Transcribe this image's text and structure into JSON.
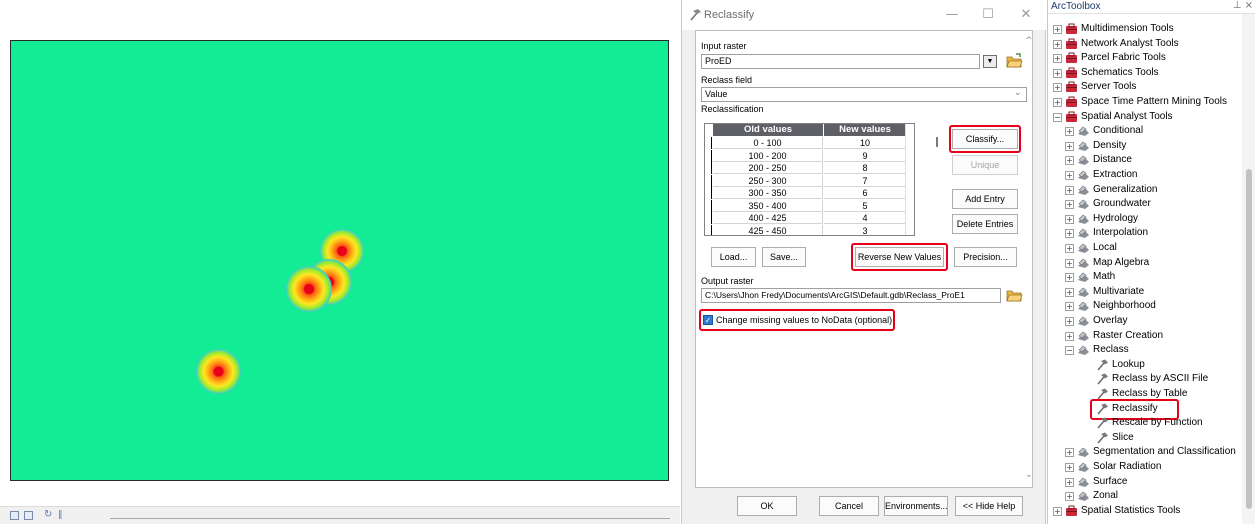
{
  "colors": {
    "raster_background": "#12ec94",
    "highlight": "#e6001a",
    "table_header": "#5f6066"
  },
  "dialog": {
    "title": "Reclassify",
    "input_raster": {
      "label": "Input raster",
      "value": "ProED"
    },
    "reclass_field": {
      "label": "Reclass field",
      "value": "Value"
    },
    "reclassification_label": "Reclassification",
    "table": {
      "columns": [
        "Old values",
        "New values"
      ],
      "rows": [
        {
          "old": "0 - 100",
          "new": "10"
        },
        {
          "old": "100 - 200",
          "new": "9"
        },
        {
          "old": "200 - 250",
          "new": "8"
        },
        {
          "old": "250 - 300",
          "new": "7"
        },
        {
          "old": "300 - 350",
          "new": "6"
        },
        {
          "old": "350 - 400",
          "new": "5"
        },
        {
          "old": "400 - 425",
          "new": "4"
        },
        {
          "old": "425 - 450",
          "new": "3"
        }
      ]
    },
    "side_buttons": {
      "classify": "Classify...",
      "unique": "Unique",
      "add_entry": "Add Entry",
      "delete_entries": "Delete Entries"
    },
    "bottom_buttons": {
      "load": "Load...",
      "save": "Save...",
      "reverse": "Reverse New Values",
      "precision": "Precision..."
    },
    "output_raster": {
      "label": "Output raster",
      "value": "C:\\Users\\Jhon Fredy\\Documents\\ArcGIS\\Default.gdb\\Reclass_ProE1"
    },
    "missing_nodata": {
      "label": "Change missing values to NoData (optional)",
      "checked": true
    },
    "footer": {
      "ok": "OK",
      "cancel": "Cancel",
      "environments": "Environments...",
      "hide_help": "<< Hide Help"
    }
  },
  "toolbox": {
    "title": "ArcToolbox",
    "pins": "ᵘ ×",
    "items": [
      {
        "label": "Multidimension Tools",
        "level": 0,
        "expander": "+",
        "icon": "toolbox-icon"
      },
      {
        "label": "Network Analyst Tools",
        "level": 0,
        "expander": "+",
        "icon": "toolbox-icon"
      },
      {
        "label": "Parcel Fabric Tools",
        "level": 0,
        "expander": "+",
        "icon": "toolbox-icon"
      },
      {
        "label": "Schematics Tools",
        "level": 0,
        "expander": "+",
        "icon": "toolbox-icon"
      },
      {
        "label": "Server Tools",
        "level": 0,
        "expander": "+",
        "icon": "toolbox-icon"
      },
      {
        "label": "Space Time Pattern Mining Tools",
        "level": 0,
        "expander": "+",
        "icon": "toolbox-icon"
      },
      {
        "label": "Spatial Analyst Tools",
        "level": 0,
        "expander": "-",
        "icon": "toolbox-icon"
      },
      {
        "label": "Conditional",
        "level": 1,
        "expander": "+",
        "icon": "toolset-icon"
      },
      {
        "label": "Density",
        "level": 1,
        "expander": "+",
        "icon": "toolset-icon"
      },
      {
        "label": "Distance",
        "level": 1,
        "expander": "+",
        "icon": "toolset-icon"
      },
      {
        "label": "Extraction",
        "level": 1,
        "expander": "+",
        "icon": "toolset-icon"
      },
      {
        "label": "Generalization",
        "level": 1,
        "expander": "+",
        "icon": "toolset-icon"
      },
      {
        "label": "Groundwater",
        "level": 1,
        "expander": "+",
        "icon": "toolset-icon"
      },
      {
        "label": "Hydrology",
        "level": 1,
        "expander": "+",
        "icon": "toolset-icon"
      },
      {
        "label": "Interpolation",
        "level": 1,
        "expander": "+",
        "icon": "toolset-icon"
      },
      {
        "label": "Local",
        "level": 1,
        "expander": "+",
        "icon": "toolset-icon"
      },
      {
        "label": "Map Algebra",
        "level": 1,
        "expander": "+",
        "icon": "toolset-icon"
      },
      {
        "label": "Math",
        "level": 1,
        "expander": "+",
        "icon": "toolset-icon"
      },
      {
        "label": "Multivariate",
        "level": 1,
        "expander": "+",
        "icon": "toolset-icon"
      },
      {
        "label": "Neighborhood",
        "level": 1,
        "expander": "+",
        "icon": "toolset-icon"
      },
      {
        "label": "Overlay",
        "level": 1,
        "expander": "+",
        "icon": "toolset-icon"
      },
      {
        "label": "Raster Creation",
        "level": 1,
        "expander": "+",
        "icon": "toolset-icon"
      },
      {
        "label": "Reclass",
        "level": 1,
        "expander": "-",
        "icon": "toolset-icon"
      },
      {
        "label": "Lookup",
        "level": 2,
        "expander": "",
        "icon": "hammer-icon"
      },
      {
        "label": "Reclass by ASCII File",
        "level": 2,
        "expander": "",
        "icon": "hammer-icon"
      },
      {
        "label": "Reclass by Table",
        "level": 2,
        "expander": "",
        "icon": "hammer-icon"
      },
      {
        "label": "Reclassify",
        "level": 2,
        "expander": "",
        "icon": "hammer-icon",
        "highlighted": true
      },
      {
        "label": "Rescale by Function",
        "level": 2,
        "expander": "",
        "icon": "hammer-icon"
      },
      {
        "label": "Slice",
        "level": 2,
        "expander": "",
        "icon": "hammer-icon"
      },
      {
        "label": "Segmentation and Classification",
        "level": 1,
        "expander": "+",
        "icon": "toolset-icon"
      },
      {
        "label": "Solar Radiation",
        "level": 1,
        "expander": "+",
        "icon": "toolset-icon"
      },
      {
        "label": "Surface",
        "level": 1,
        "expander": "+",
        "icon": "toolset-icon"
      },
      {
        "label": "Zonal",
        "level": 1,
        "expander": "+",
        "icon": "toolset-icon"
      },
      {
        "label": "Spatial Statistics Tools",
        "level": 0,
        "expander": "+",
        "icon": "toolbox-icon"
      }
    ]
  }
}
